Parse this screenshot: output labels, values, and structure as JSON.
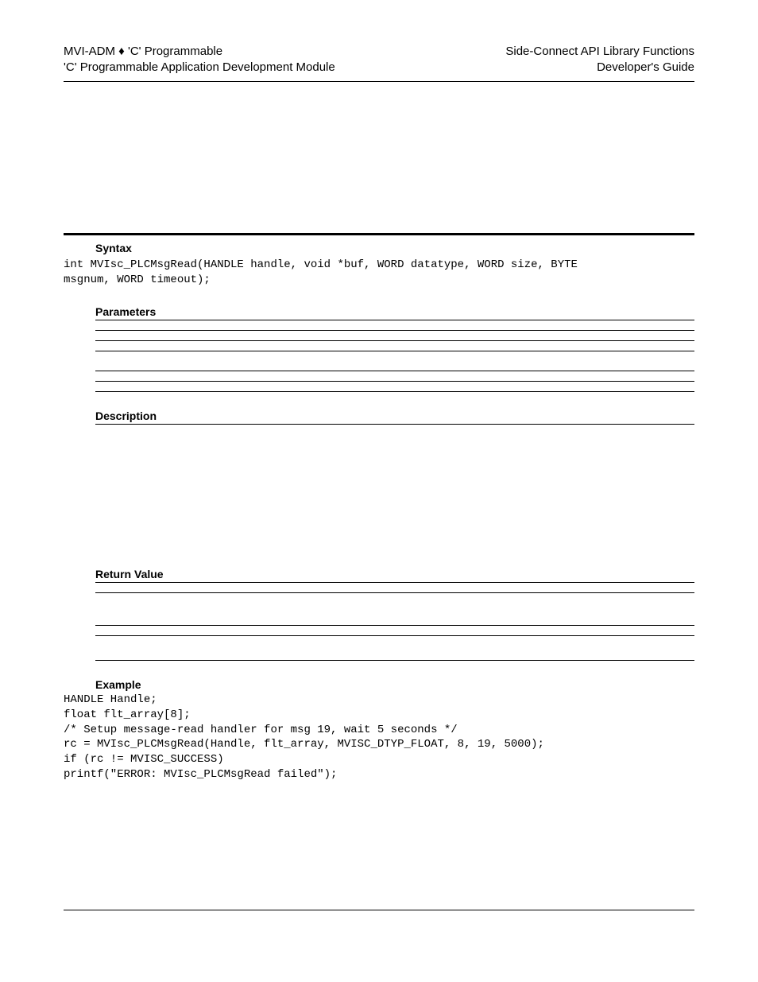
{
  "header": {
    "left_line1": "MVI-ADM ♦ 'C' Programmable",
    "left_line2": "'C' Programmable Application Development Module",
    "right_line1": "Side-Connect API Library Functions",
    "right_line2": "Developer's Guide"
  },
  "sections": {
    "syntax_label": "Syntax",
    "syntax_code": "int MVIsc_PLCMsgRead(HANDLE handle, void *buf, WORD datatype, WORD size, BYTE\nmsgnum, WORD timeout);",
    "parameters_label": "Parameters",
    "description_label": "Description",
    "return_value_label": "Return Value",
    "example_label": "Example",
    "example_code": "HANDLE Handle;\nfloat flt_array[8];\n/* Setup message-read handler for msg 19, wait 5 seconds */\nrc = MVIsc_PLCMsgRead(Handle, flt_array, MVISC_DTYP_FLOAT, 8, 19, 5000);\nif (rc != MVISC_SUCCESS)\nprintf(\"ERROR: MVIsc_PLCMsgRead failed\");"
  }
}
